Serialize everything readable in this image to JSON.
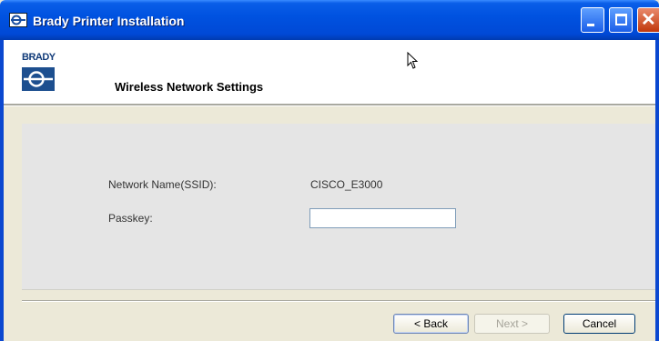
{
  "window": {
    "title": "Brady Printer Installation"
  },
  "header": {
    "logo_text": "BRADY",
    "title": "Wireless Network Settings"
  },
  "form": {
    "ssid_label": "Network Name(SSID):",
    "ssid_value": "CISCO_E3000",
    "passkey_label": "Passkey:",
    "passkey_value": ""
  },
  "buttons": {
    "back": "< Back",
    "next": "Next >",
    "cancel": "Cancel"
  },
  "colors": {
    "titlebar": "#0052e0",
    "content_bg": "#e5e5e5",
    "dialog_bg": "#ece9d8"
  }
}
